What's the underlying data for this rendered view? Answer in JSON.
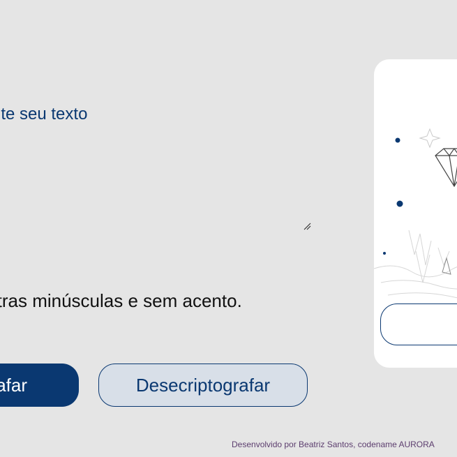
{
  "input": {
    "placeholder": "Digite seu texto"
  },
  "warning": {
    "text": "Apenas letras minúsculas e sem acento."
  },
  "buttons": {
    "encrypt_label": "Criptografar",
    "decrypt_label": "Desecriptografar",
    "copy_label": ""
  },
  "output": {
    "illustration": "diamond-illustration"
  },
  "footer": {
    "text": "Desenvolvido por Beatriz Santos, codename AURORA"
  },
  "colors": {
    "background": "#e5e5e5",
    "primary": "#0a3871",
    "secondary_button_bg": "#d8dfe8",
    "card": "#ffffff",
    "footer_text": "#5c3d6e"
  }
}
